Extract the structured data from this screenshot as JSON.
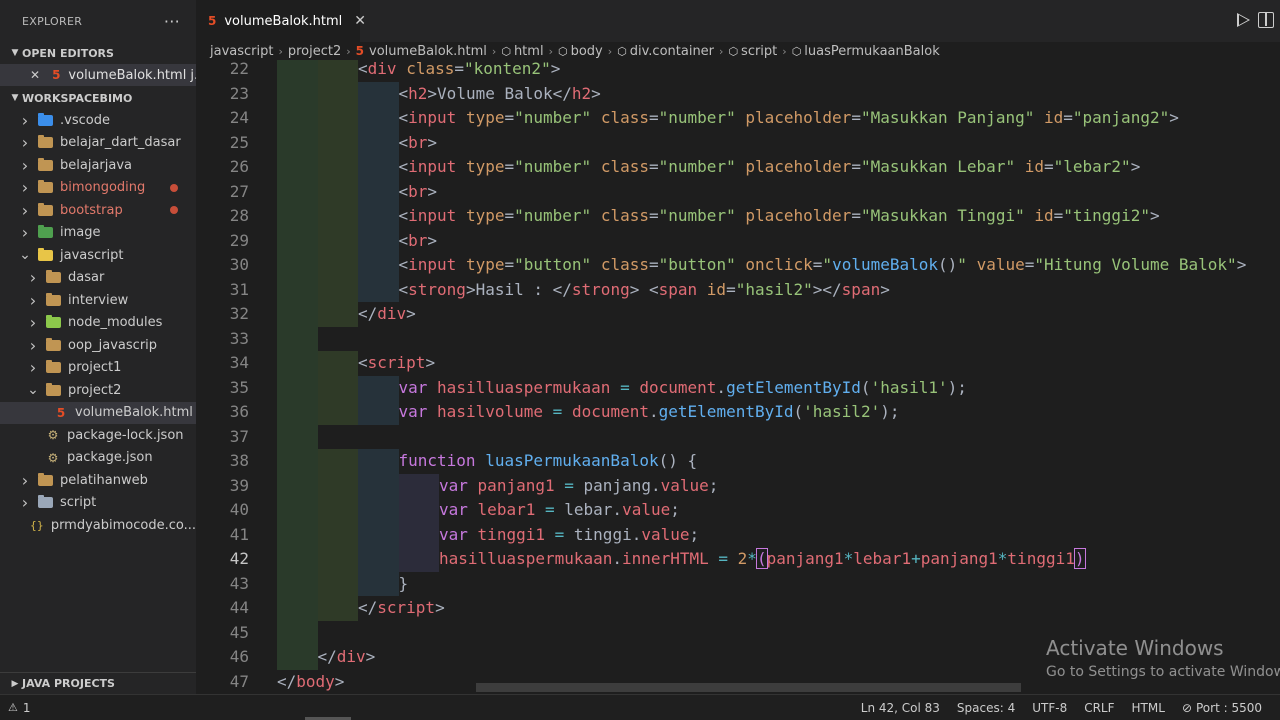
{
  "sidebar": {
    "title": "EXPLORER",
    "more_glyph": "···",
    "open_editors": {
      "label": "OPEN EDITORS",
      "files": [
        {
          "name": "volumeBalok.html j..."
        }
      ]
    },
    "workspace": {
      "label": "WORKSPACEBIMO",
      "items": [
        {
          "name": ".vscode",
          "kind": "folder",
          "color": "#3b8eea",
          "depth": 1,
          "expanded": false
        },
        {
          "name": "belajar_dart_dasar",
          "kind": "folder",
          "color": "#c09553",
          "depth": 1,
          "expanded": false
        },
        {
          "name": "belajarjava",
          "kind": "folder",
          "color": "#c09553",
          "depth": 1,
          "expanded": false
        },
        {
          "name": "bimongoding",
          "kind": "folder",
          "color": "#c09553",
          "depth": 1,
          "expanded": false,
          "modified": true
        },
        {
          "name": "bootstrap",
          "kind": "folder",
          "color": "#c09553",
          "depth": 1,
          "expanded": false,
          "modified": true
        },
        {
          "name": "image",
          "kind": "folder",
          "color": "#4fa04f",
          "depth": 1,
          "expanded": false
        },
        {
          "name": "javascript",
          "kind": "folder",
          "color": "#e8c547",
          "depth": 1,
          "expanded": true
        },
        {
          "name": "dasar",
          "kind": "folder",
          "color": "#c09553",
          "depth": 2,
          "expanded": false
        },
        {
          "name": "interview",
          "kind": "folder",
          "color": "#c09553",
          "depth": 2,
          "expanded": false
        },
        {
          "name": "node_modules",
          "kind": "folder",
          "color": "#8cc84b",
          "depth": 2,
          "expanded": false
        },
        {
          "name": "oop_javascrip",
          "kind": "folder",
          "color": "#c09553",
          "depth": 2,
          "expanded": false
        },
        {
          "name": "project1",
          "kind": "folder",
          "color": "#c09553",
          "depth": 2,
          "expanded": false
        },
        {
          "name": "project2",
          "kind": "folder",
          "color": "#c09553",
          "depth": 2,
          "expanded": true
        },
        {
          "name": "volumeBalok.html",
          "kind": "html",
          "depth": 3,
          "selected": true
        },
        {
          "name": "package-lock.json",
          "kind": "json",
          "depth": 2
        },
        {
          "name": "package.json",
          "kind": "json",
          "depth": 2
        },
        {
          "name": "pelatihanweb",
          "kind": "folder",
          "color": "#c09553",
          "depth": 1,
          "expanded": false
        },
        {
          "name": "script",
          "kind": "folder",
          "color": "#9aa7b8",
          "depth": 1,
          "expanded": false
        },
        {
          "name": "prmdyabimocode.co...",
          "kind": "braces",
          "depth": 1
        }
      ]
    },
    "java_projects": "JAVA PROJECTS"
  },
  "tab": {
    "name": "volumeBalok.html",
    "icon": "html5-icon"
  },
  "breadcrumb": [
    "javascript",
    "project2",
    "volumeBalok.html",
    "html",
    "body",
    "div.container",
    "script",
    "luasPermukaanBalok"
  ],
  "editor": {
    "active_line": 42,
    "lines": [
      {
        "n": 22,
        "indent": 2,
        "html": "<span class=\"br\">&lt;</span><span class=\"tag\">div</span> <span class=\"attr\">class</span><span class=\"plain\">=</span><span class=\"str\">\"konten2\"</span><span class=\"br\">&gt;</span>"
      },
      {
        "n": 23,
        "indent": 3,
        "html": "<span class=\"br\">&lt;</span><span class=\"tag\">h2</span><span class=\"br\">&gt;</span><span class=\"plain\">Volume Balok</span><span class=\"br\">&lt;/</span><span class=\"tag\">h2</span><span class=\"br\">&gt;</span>"
      },
      {
        "n": 24,
        "indent": 3,
        "html": "<span class=\"br\">&lt;</span><span class=\"tag\">input</span> <span class=\"attr\">type</span><span class=\"plain\">=</span><span class=\"str\">\"number\"</span> <span class=\"attr\">class</span><span class=\"plain\">=</span><span class=\"str\">\"number\"</span> <span class=\"attr\">placeholder</span><span class=\"plain\">=</span><span class=\"str\">\"Masukkan Panjang\"</span> <span class=\"attr\">id</span><span class=\"plain\">=</span><span class=\"str\">\"panjang2\"</span><span class=\"br\">&gt;</span>"
      },
      {
        "n": 25,
        "indent": 3,
        "html": "<span class=\"br\">&lt;</span><span class=\"tag\">br</span><span class=\"br\">&gt;</span>"
      },
      {
        "n": 26,
        "indent": 3,
        "html": "<span class=\"br\">&lt;</span><span class=\"tag\">input</span> <span class=\"attr\">type</span><span class=\"plain\">=</span><span class=\"str\">\"number\"</span> <span class=\"attr\">class</span><span class=\"plain\">=</span><span class=\"str\">\"number\"</span> <span class=\"attr\">placeholder</span><span class=\"plain\">=</span><span class=\"str\">\"Masukkan Lebar\"</span> <span class=\"attr\">id</span><span class=\"plain\">=</span><span class=\"str\">\"lebar2\"</span><span class=\"br\">&gt;</span>"
      },
      {
        "n": 27,
        "indent": 3,
        "html": "<span class=\"br\">&lt;</span><span class=\"tag\">br</span><span class=\"br\">&gt;</span>"
      },
      {
        "n": 28,
        "indent": 3,
        "html": "<span class=\"br\">&lt;</span><span class=\"tag\">input</span> <span class=\"attr\">type</span><span class=\"plain\">=</span><span class=\"str\">\"number\"</span> <span class=\"attr\">class</span><span class=\"plain\">=</span><span class=\"str\">\"number\"</span> <span class=\"attr\">placeholder</span><span class=\"plain\">=</span><span class=\"str\">\"Masukkan Tinggi\"</span> <span class=\"attr\">id</span><span class=\"plain\">=</span><span class=\"str\">\"tinggi2\"</span><span class=\"br\">&gt;</span>"
      },
      {
        "n": 29,
        "indent": 3,
        "html": "<span class=\"br\">&lt;</span><span class=\"tag\">br</span><span class=\"br\">&gt;</span>"
      },
      {
        "n": 30,
        "indent": 3,
        "html": "<span class=\"br\">&lt;</span><span class=\"tag\">input</span> <span class=\"attr\">type</span><span class=\"plain\">=</span><span class=\"str\">\"button\"</span> <span class=\"attr\">class</span><span class=\"plain\">=</span><span class=\"str\">\"button\"</span> <span class=\"attr\">onclick</span><span class=\"plain\">=</span><span class=\"str\">\"</span><span class=\"fn\">volumeBalok</span><span class=\"plain\">()</span><span class=\"str\">\"</span> <span class=\"attr\">value</span><span class=\"plain\">=</span><span class=\"str\">\"Hitung Volume Balok\"</span><span class=\"br\">&gt;</span>"
      },
      {
        "n": 31,
        "indent": 3,
        "html": "<span class=\"br\">&lt;</span><span class=\"tag\">strong</span><span class=\"br\">&gt;</span><span class=\"plain\">Hasil : </span><span class=\"br\">&lt;/</span><span class=\"tag\">strong</span><span class=\"br\">&gt;</span> <span class=\"br\">&lt;</span><span class=\"tag\">span</span> <span class=\"attr\">id</span><span class=\"plain\">=</span><span class=\"str\">\"hasil2\"</span><span class=\"br\">&gt;&lt;/</span><span class=\"tag\">span</span><span class=\"br\">&gt;</span>"
      },
      {
        "n": 32,
        "indent": 2,
        "html": "<span class=\"br\">&lt;/</span><span class=\"tag\">div</span><span class=\"br\">&gt;</span>"
      },
      {
        "n": 33,
        "indent": 1,
        "html": ""
      },
      {
        "n": 34,
        "indent": 2,
        "html": "<span class=\"br\">&lt;</span><span class=\"tag\">script</span><span class=\"br\">&gt;</span>"
      },
      {
        "n": 35,
        "indent": 3,
        "html": "<span class=\"kw\">var</span> <span class=\"var\">hasilluaspermukaan</span> <span class=\"op\">=</span> <span class=\"var\">document</span><span class=\"plain\">.</span><span class=\"fn\">getElementById</span><span class=\"plain\">(</span><span class=\"str\">'hasil1'</span><span class=\"plain\">);</span>"
      },
      {
        "n": 36,
        "indent": 3,
        "html": "<span class=\"kw\">var</span> <span class=\"var\">hasilvolume</span> <span class=\"op\">=</span> <span class=\"var\">document</span><span class=\"plain\">.</span><span class=\"fn\">getElementById</span><span class=\"plain\">(</span><span class=\"str\">'hasil2'</span><span class=\"plain\">);</span>"
      },
      {
        "n": 37,
        "indent": 1,
        "html": ""
      },
      {
        "n": 38,
        "indent": 3,
        "html": "<span class=\"kw\">function</span> <span class=\"fn\">luasPermukaanBalok</span><span class=\"plain\">() {</span>"
      },
      {
        "n": 39,
        "indent": 4,
        "html": "<span class=\"kw\">var</span> <span class=\"var\">panjang1</span> <span class=\"op\">=</span> <span class=\"plain\">panjang.</span><span class=\"var\">value</span><span class=\"plain\">;</span>"
      },
      {
        "n": 40,
        "indent": 4,
        "html": "<span class=\"kw\">var</span> <span class=\"var\">lebar1</span> <span class=\"op\">=</span> <span class=\"plain\">lebar.</span><span class=\"var\">value</span><span class=\"plain\">;</span>"
      },
      {
        "n": 41,
        "indent": 4,
        "html": "<span class=\"kw\">var</span> <span class=\"var\">tinggi1</span> <span class=\"op\">=</span> <span class=\"plain\">tinggi.</span><span class=\"var\">value</span><span class=\"plain\">;</span>"
      },
      {
        "n": 42,
        "indent": 4,
        "html": "<span class=\"var\">hasilluaspermukaan</span><span class=\"plain\">.</span><span class=\"var\">innerHTML</span> <span class=\"op\">=</span> <span class=\"num\">2</span><span class=\"op\">*</span><span class=\"kw bracket-hl\">(</span><span class=\"var\">panjang1</span><span class=\"op\">*</span><span class=\"var\">lebar1</span><span class=\"op\">+</span><span class=\"var\">panjang1</span><span class=\"op\">*</span><span class=\"var\">tinggi1</span><span class=\"kw bracket-hl\">)</span>"
      },
      {
        "n": 43,
        "indent": 3,
        "html": "<span class=\"plain\">}</span>"
      },
      {
        "n": 44,
        "indent": 2,
        "html": "<span class=\"br\">&lt;/</span><span class=\"tag\">script</span><span class=\"br\">&gt;</span>"
      },
      {
        "n": 45,
        "indent": 1,
        "html": ""
      },
      {
        "n": 46,
        "indent": 1,
        "html": "<span class=\"br\">&lt;/</span><span class=\"tag\">div</span><span class=\"br\">&gt;</span>"
      },
      {
        "n": 47,
        "indent": 0,
        "html": "<span class=\"br\">&lt;/</span><span class=\"tag\">body</span><span class=\"br\">&gt;</span>"
      }
    ]
  },
  "watermark": {
    "title": "Activate Windows",
    "subtitle": "Go to Settings to activate Windows."
  },
  "status": {
    "problems": "1",
    "position": "Ln 42, Col 83",
    "spaces": "Spaces: 4",
    "encoding": "UTF-8",
    "eol": "CRLF",
    "language": "HTML",
    "port": "Port : 5500"
  },
  "colors": {
    "indent_guide_1": "#2a3a2a",
    "indent_guide_2": "#2f3a27",
    "indent_guide_3": "#26323a",
    "indent_guide_4": "#2c2c3a"
  }
}
